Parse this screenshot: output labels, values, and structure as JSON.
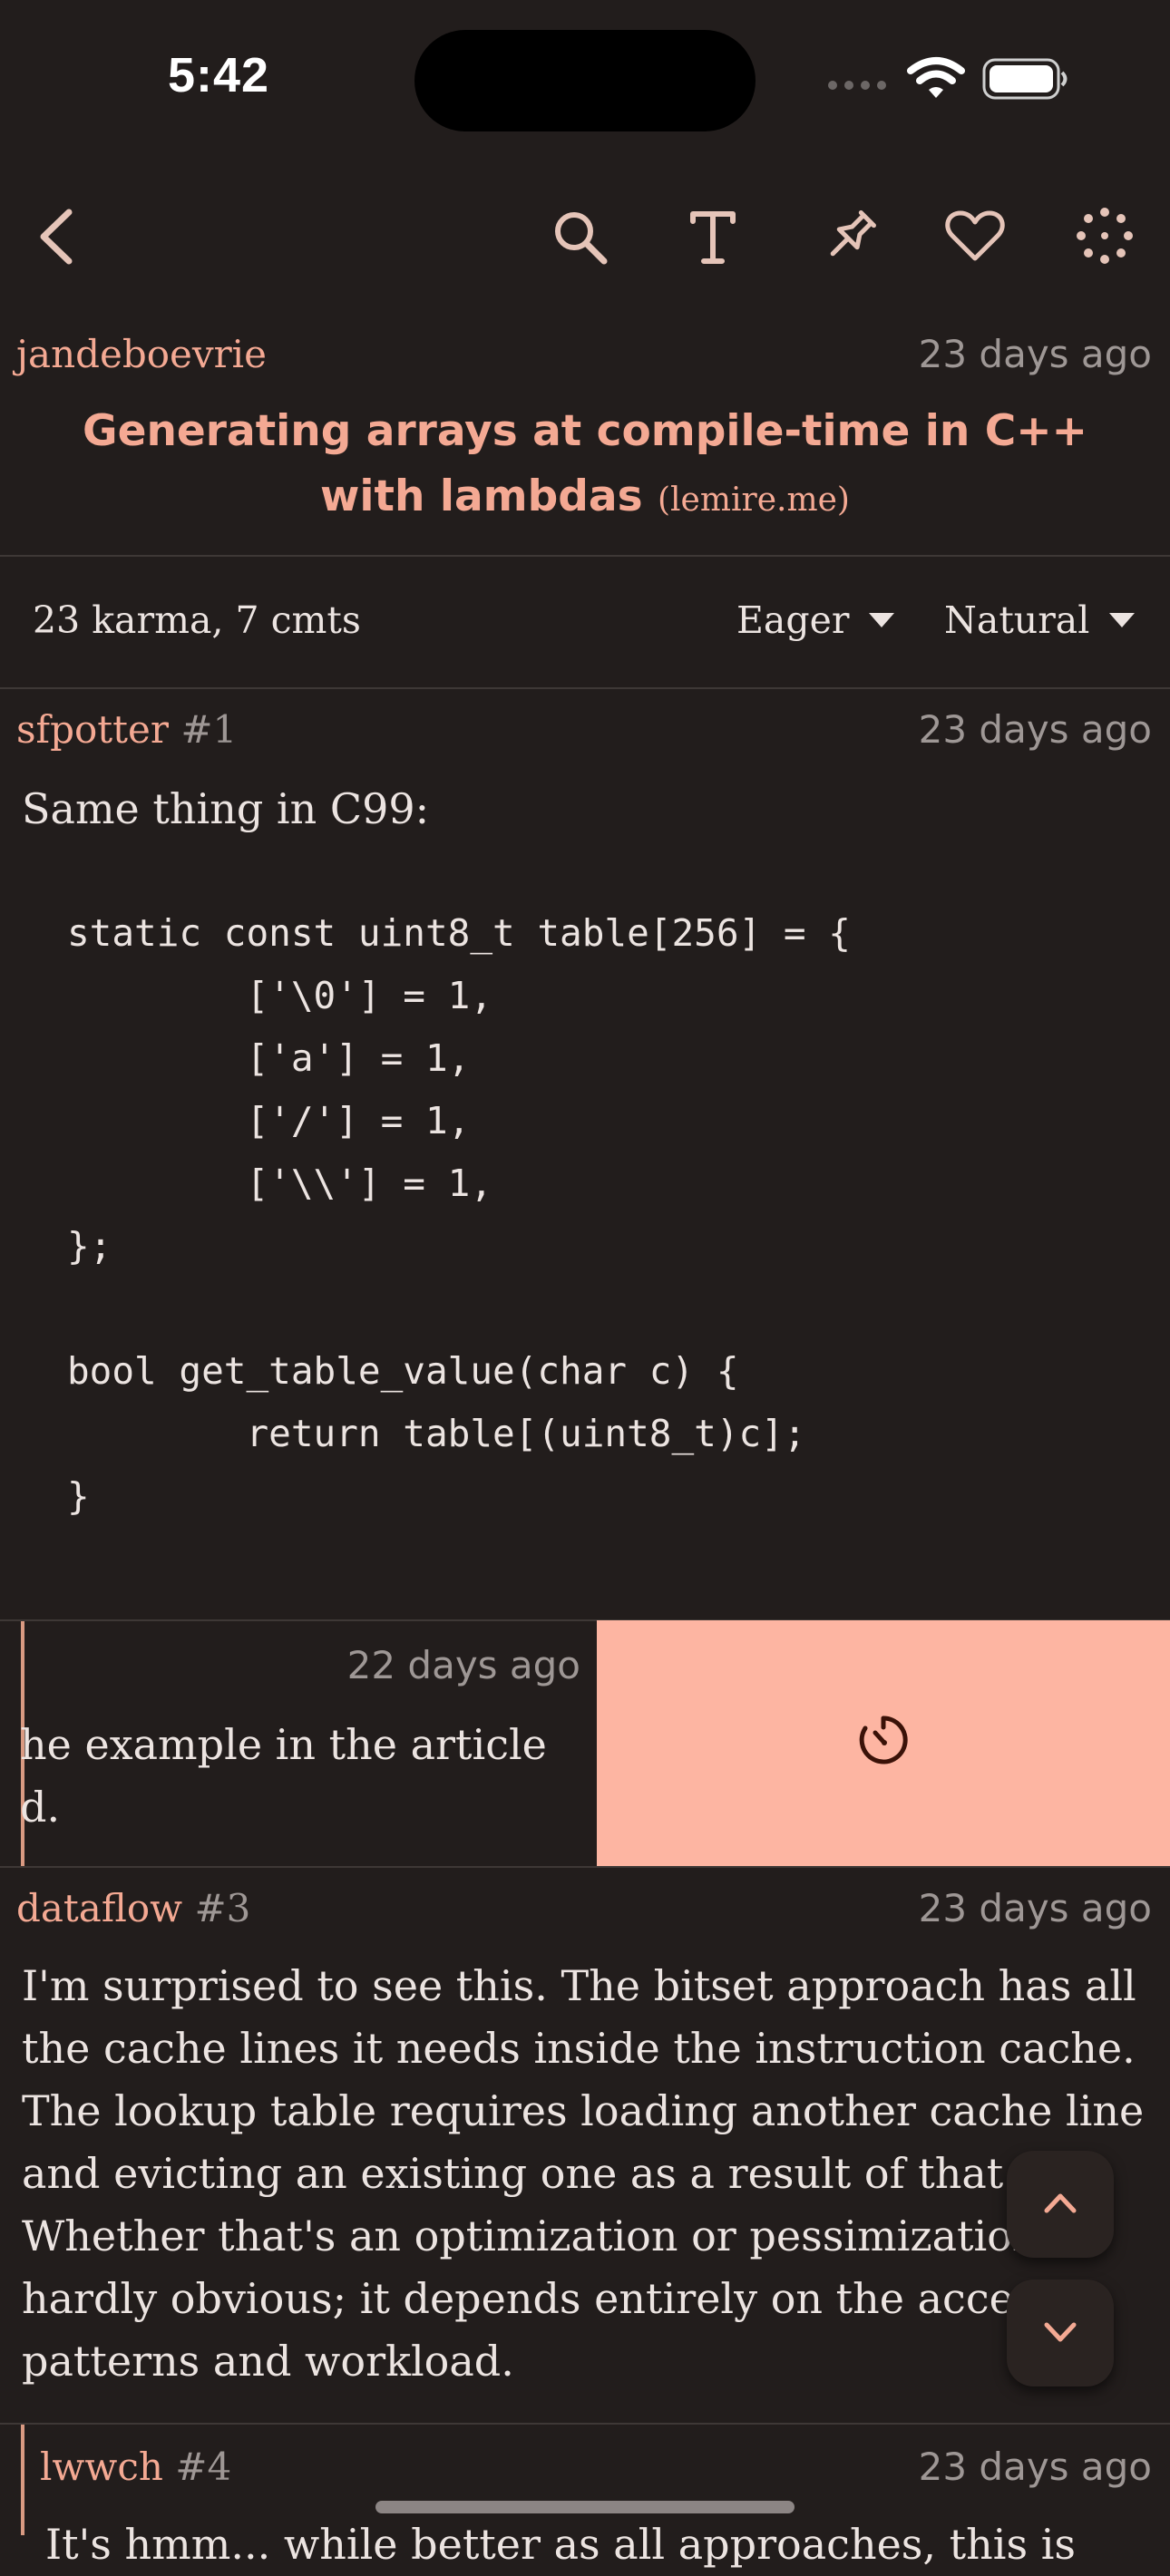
{
  "status_bar": {
    "time": "5:42"
  },
  "toolbar": {
    "back_icon": "chevron-left-icon",
    "icons": [
      "search-icon",
      "text-size-icon",
      "pin-icon",
      "heart-icon",
      "loading-spinner-icon"
    ]
  },
  "post": {
    "author": "jandeboevrie",
    "time": "23 days ago",
    "title": "Generating arrays at compile-time in C++ with lambdas",
    "domain": "(lemire.me)"
  },
  "meta_bar": {
    "stats": "23 karma, 7 cmts",
    "filter_label": "Eager",
    "sort_label": "Natural"
  },
  "comments": [
    {
      "author": "sfpotter",
      "index": "#1",
      "time": "23 days ago",
      "intro": "Same thing in C99:",
      "code": "static const uint8_t table[256] = {\n        ['\\0'] = 1,\n        ['a'] = 1,\n        ['/'] = 1,\n        ['\\\\'] = 1,\n};\n\nbool get_table_value(char c) {\n        return table[(uint8_t)c];\n}"
    },
    {
      "time": "22 days ago",
      "line1": "he example in the article",
      "line2": "d.",
      "swipe_icon": "snooze-timer-icon"
    },
    {
      "author": "dataflow",
      "index": "#3",
      "time": "23 days ago",
      "lines": [
        "I'm surprised to see this. The bitset approach has all",
        "the cache lines it needs inside the instruction cache.",
        "The lookup table requires loading another cache line",
        "and evicting an existing one as a result of that.",
        "Whether that's an optimization or pessimization is",
        "hardly obvious; it depends entirely on the access",
        "patterns and workload."
      ]
    },
    {
      "author": "lwwch",
      "index": "#4",
      "time": "23 days ago",
      "partial": "It's hmm... while better as all approaches, this is"
    }
  ],
  "fab": {
    "up_icon": "chevron-up-icon",
    "down_icon": "chevron-down-icon"
  },
  "colors": {
    "background": "#221d1c",
    "accent": "#f4a993",
    "swipe": "#fdb5a2",
    "muted": "#9e9795"
  }
}
